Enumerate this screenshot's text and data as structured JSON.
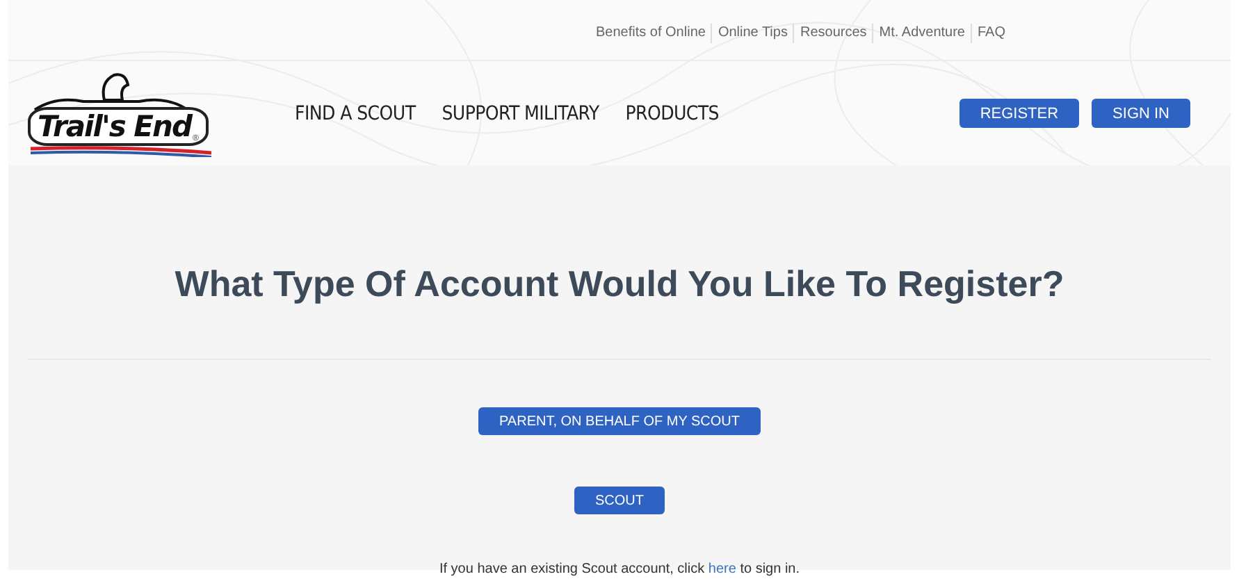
{
  "top_links": [
    "Benefits of Online",
    "Online Tips",
    "Resources",
    "Mt. Adventure",
    "FAQ"
  ],
  "logo": {
    "text": "Trail's End",
    "mark": "®"
  },
  "nav": [
    "FIND A SCOUT",
    "SUPPORT MILITARY",
    "PRODUCTS"
  ],
  "header_buttons": [
    "REGISTER",
    "SIGN IN"
  ],
  "heading": "What Type Of Account Would You Like To Register?",
  "account_buttons": [
    "PARENT, ON BEHALF OF MY SCOUT",
    "SCOUT"
  ],
  "signin_note": {
    "before": "If you have an existing Scout account, click ",
    "link": "here",
    "after": " to sign in."
  }
}
